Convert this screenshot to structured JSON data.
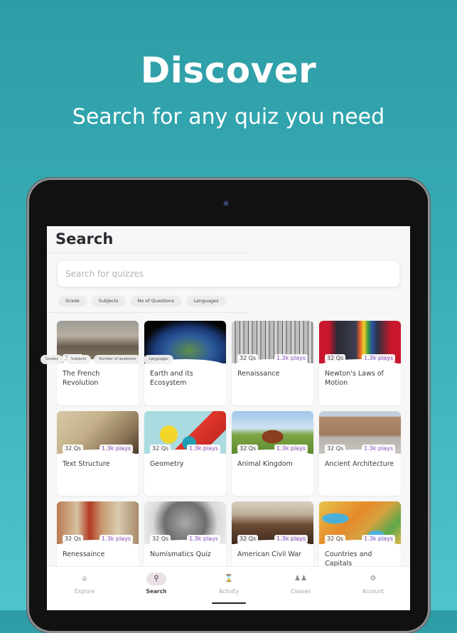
{
  "hero": {
    "title": "Discover",
    "subtitle": "Search for any quiz you need"
  },
  "app": {
    "page_title": "Search",
    "search": {
      "placeholder": "Search for quizzes",
      "value": ""
    },
    "filters": [
      "Grade",
      "Subjects",
      "No of Questions",
      "Languages"
    ],
    "overlay_filters": [
      "Grades",
      "Subjects",
      "Number of questions",
      "Languages"
    ],
    "quizzes": [
      {
        "title": "The French Revolution",
        "questions": "32 Qs",
        "plays": "",
        "image": "storming-bastille-painting"
      },
      {
        "title": "Earth and its Ecosystem",
        "questions": "",
        "plays": "",
        "image": "earth-from-space"
      },
      {
        "title": "Renaissance",
        "questions": "32 Qs",
        "plays": "1.3k plays",
        "image": "industrial-factory-photo"
      },
      {
        "title": "Newton's Laws of Motion",
        "questions": "32 Qs",
        "plays": "1.3k plays",
        "image": "prism-head-illustration"
      },
      {
        "title": "Text Structure",
        "questions": "32 Qs",
        "plays": "1.3k plays",
        "image": "dictionary-page"
      },
      {
        "title": "Geometry",
        "questions": "32 Qs",
        "plays": "1.3k plays",
        "image": "geometric-shapes"
      },
      {
        "title": "Animal Kingdom",
        "questions": "32 Qs",
        "plays": "1.3k plays",
        "image": "longhorn-cattle"
      },
      {
        "title": "Ancient Architecture",
        "questions": "32 Qs",
        "plays": "1.3k plays",
        "image": "ziggurat"
      },
      {
        "title": "Renessaince",
        "questions": "32 Qs",
        "plays": "1.3k plays",
        "image": "medieval-painting"
      },
      {
        "title": "Numismatics Quiz",
        "questions": "32 Qs",
        "plays": "1.3k plays",
        "image": "coin-portrait"
      },
      {
        "title": "American Civil War",
        "questions": "32 Qs",
        "plays": "1.3k plays",
        "image": "crossing-delaware-painting"
      },
      {
        "title": "Countries and Capitals",
        "questions": "32 Qs",
        "plays": "1.3k plays",
        "image": "middle-east-map"
      }
    ],
    "nav": [
      {
        "label": "Explore",
        "icon": "home-icon",
        "active": false
      },
      {
        "label": "Search",
        "icon": "search-icon",
        "active": true
      },
      {
        "label": "Activity",
        "icon": "hourglass-icon",
        "active": false
      },
      {
        "label": "Classes",
        "icon": "people-icon",
        "active": false
      },
      {
        "label": "Account",
        "icon": "gear-icon",
        "active": false
      }
    ]
  },
  "colors": {
    "background_top": "#2e9ca5",
    "background_bottom": "#4ec4cd",
    "plays_accent": "#8a4fc1",
    "active_nav_bg": "#e9e0e6"
  }
}
